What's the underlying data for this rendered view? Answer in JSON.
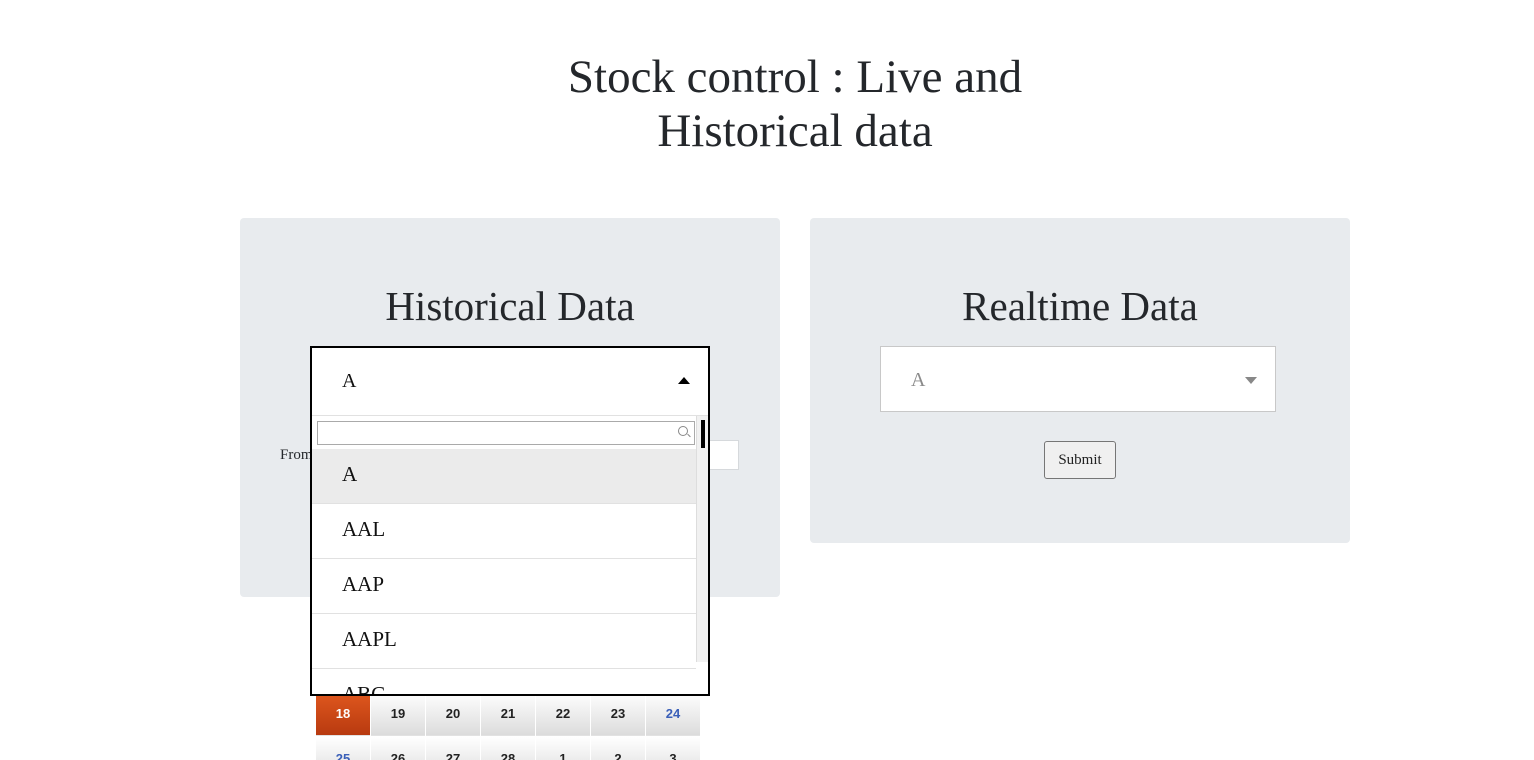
{
  "page": {
    "title_line1": "Stock control : Live and",
    "title_line2": "Historical data"
  },
  "historical": {
    "heading": "Historical Data",
    "selected_symbol": "A",
    "search_value": "",
    "options": [
      "A",
      "AAL",
      "AAP",
      "AAPL",
      "ABC"
    ],
    "from_label": "From"
  },
  "realtime": {
    "heading": "Realtime Data",
    "selected_symbol": "A",
    "submit_label": "Submit"
  },
  "calendar": {
    "week1": [
      "18",
      "19",
      "20",
      "21",
      "22",
      "23",
      "24"
    ],
    "week2": [
      "25",
      "26",
      "27",
      "28",
      "1",
      "2",
      "3"
    ],
    "today": "18",
    "today_color": "#d34a15",
    "weekend_color": "#3a5fb8"
  }
}
